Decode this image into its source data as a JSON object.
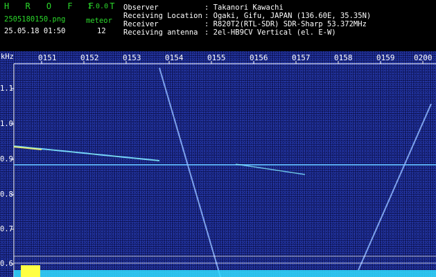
{
  "header": {
    "brand": "H R O F F T",
    "version": "1.0.0",
    "filename": "2505180150.png",
    "datetime": "25.05.18 01:50",
    "meteor_label": "meteor",
    "meteor_count": "12",
    "fields": [
      {
        "label": "Observer",
        "value": ": Takanori Kawachi"
      },
      {
        "label": "Receiving Location",
        "value": ": Ogaki, Gifu, JAPAN (136.60E, 35.35N)"
      },
      {
        "label": "Receiver",
        "value": ": R820T2(RTL-SDR) SDR-Sharp 53.372MHz"
      },
      {
        "label": "Receiving antenna",
        "value": ": 2el-HB9CV Vertical (el. E-W)"
      }
    ]
  },
  "axis": {
    "y_unit": "kHz",
    "time_ticks": [
      "0151",
      "0152",
      "0153",
      "0154",
      "0155",
      "0156",
      "0157",
      "0158",
      "0159",
      "0200"
    ],
    "freq_ticks": [
      "1.1",
      "1.0",
      "0.9",
      "0.8",
      "0.7",
      "0.6"
    ]
  },
  "colors": {
    "header_text": "#ffffff",
    "brand": "#2bd92b",
    "background": "#0b0f4a",
    "noise": "#2a3fb8",
    "carrier": "#5fb8ff",
    "baseline": "#33ddff"
  }
}
